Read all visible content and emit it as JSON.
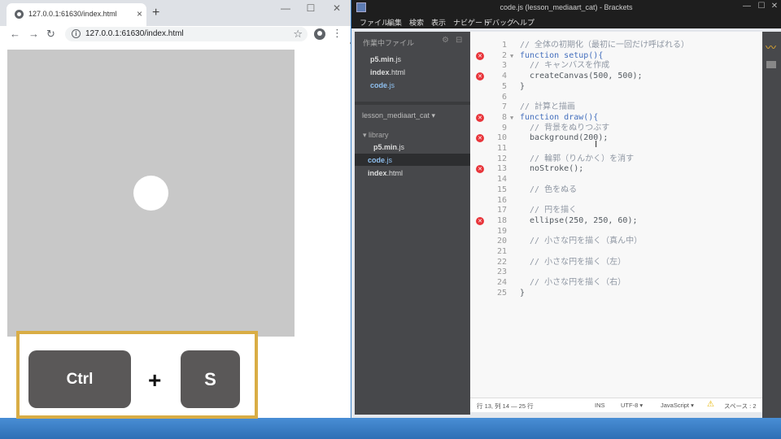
{
  "browser": {
    "tab_title": "127.0.0.1:61630/index.html",
    "tab_close": "×",
    "new_tab": "+",
    "window_controls": [
      "—",
      "☐",
      "✕"
    ],
    "nav": {
      "back": "←",
      "forward": "→",
      "reload": "↻"
    },
    "url": "127.0.0.1:61630/index.html",
    "info_glyph": "i",
    "star": "☆",
    "menu": "⋮"
  },
  "shortcut": {
    "key1": "Ctrl",
    "plus": "+",
    "key2": "S"
  },
  "brackets": {
    "window_title": "code.js (lesson_mediaart_cat) - Brackets",
    "window_controls": [
      "—",
      "☐",
      "✕"
    ],
    "menus": [
      "ファイル",
      "編集",
      "検索",
      "表示",
      "ナビゲート",
      "デバッグ",
      "ヘルプ"
    ],
    "sidebar": {
      "working_files_header": "作業中ファイル",
      "working_files": [
        {
          "name": "p5.min",
          "ext": ".js"
        },
        {
          "name": "index",
          "ext": ".html"
        },
        {
          "name": "code",
          "ext": ".js"
        }
      ],
      "project_name": "lesson_mediaart_cat ▾",
      "folder_name": "▾ library",
      "tree": [
        {
          "name": "p5.min",
          "ext": ".js"
        },
        {
          "name": "code",
          "ext": ".js"
        },
        {
          "name": "index",
          "ext": ".html"
        }
      ]
    },
    "code_lines": [
      "// 全体の初期化（最初に一回だけ呼ばれる）",
      "function setup(){",
      "  // キャンバスを作成",
      "  createCanvas(500, 500);",
      "}",
      "",
      "// 計算と描画",
      "function draw(){",
      "  // 背景をぬりつぶす",
      "  background(200);",
      "",
      "  // 輪郭（りんかく）を消す",
      "  noStroke();",
      "",
      "  // 色をぬる",
      "",
      "  // 円を描く",
      "  ellipse(250, 250, 60);",
      "",
      "  // 小さな円を描く（真ん中）",
      "",
      "  // 小さな円を描く（左）",
      "",
      "  // 小さな円を描く（右）",
      "}"
    ],
    "error_lines": [
      2,
      4,
      8,
      10,
      13,
      18
    ],
    "fold_lines": [
      2,
      8
    ],
    "status": {
      "position": "行 13, 列 14 — 25 行",
      "mode": "INS",
      "encoding": "UTF-8 ▾",
      "language": "JavaScript ▾",
      "warning": "⚠",
      "indent": "スペース : 2"
    }
  },
  "colors": {
    "canvas_bg": "#c8c8c8",
    "circle": "#ffffff",
    "highlight_border": "#d9ad45",
    "key_bg": "#5a5858",
    "error_marker": "#e8353b"
  }
}
